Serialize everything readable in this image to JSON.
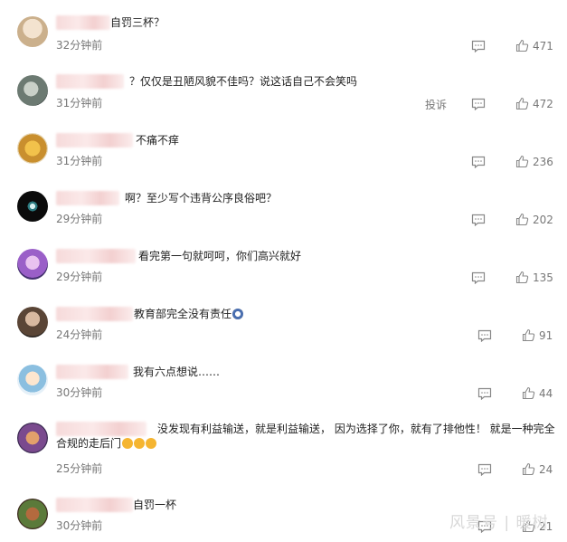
{
  "comments": [
    {
      "text": "自罚三杯？",
      "time": "32分钟前",
      "likes": "471"
    },
    {
      "text": "？仅仅是丑陋风貌不佳吗？说这话自己不会笑吗",
      "time": "31分钟前",
      "likes": "472",
      "report": "投诉"
    },
    {
      "text": "不痛不痒",
      "time": "31分钟前",
      "likes": "236"
    },
    {
      "text": "啊？至少写个违背公序良俗吧？",
      "time": "29分钟前",
      "likes": "202"
    },
    {
      "text": "看完第一句就呵呵，你们高兴就好",
      "time": "29分钟前",
      "likes": "135"
    },
    {
      "text": "教育部完全没有责任",
      "time": "24分钟前",
      "likes": "91"
    },
    {
      "text": "我有六点想说……",
      "time": "30分钟前",
      "likes": "44"
    },
    {
      "text": "没发现有利益输送，就是利益输送， 因为选择了你，就有了排他性！ 就是一种完全合规的走后门",
      "time": "25分钟前",
      "likes": "24"
    },
    {
      "text": "自罚一杯",
      "time": "30分钟前",
      "likes": "21"
    }
  ],
  "watermark": "风景号 | 暖树",
  "colors": {
    "text": "#222222",
    "meta": "#777777",
    "blur": "#f6dada"
  }
}
